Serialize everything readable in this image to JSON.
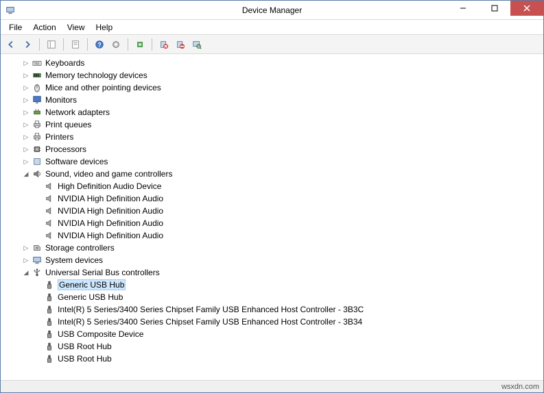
{
  "window": {
    "title": "Device Manager"
  },
  "menubar": [
    "File",
    "Action",
    "View",
    "Help"
  ],
  "toolbar_icons": [
    "nav-back-icon",
    "nav-forward-icon",
    "|",
    "show-hide-tree-icon",
    "|",
    "properties-icon",
    "|",
    "help-icon",
    "action-icon",
    "|",
    "update-driver-icon",
    "|",
    "uninstall-icon",
    "disable-icon",
    "scan-hardware-icon"
  ],
  "tree": [
    {
      "depth": 1,
      "exp": "collapsed",
      "icon": "keyboard-icon",
      "label": "Keyboards"
    },
    {
      "depth": 1,
      "exp": "collapsed",
      "icon": "memory-tech-icon",
      "label": "Memory technology devices"
    },
    {
      "depth": 1,
      "exp": "collapsed",
      "icon": "mouse-icon",
      "label": "Mice and other pointing devices"
    },
    {
      "depth": 1,
      "exp": "collapsed",
      "icon": "monitor-icon",
      "label": "Monitors"
    },
    {
      "depth": 1,
      "exp": "collapsed",
      "icon": "network-icon",
      "label": "Network adapters"
    },
    {
      "depth": 1,
      "exp": "collapsed",
      "icon": "print-queue-icon",
      "label": "Print queues"
    },
    {
      "depth": 1,
      "exp": "collapsed",
      "icon": "printer-icon",
      "label": "Printers"
    },
    {
      "depth": 1,
      "exp": "collapsed",
      "icon": "processor-icon",
      "label": "Processors"
    },
    {
      "depth": 1,
      "exp": "collapsed",
      "icon": "software-device-icon",
      "label": "Software devices"
    },
    {
      "depth": 1,
      "exp": "expanded",
      "icon": "sound-icon",
      "label": "Sound, video and game controllers"
    },
    {
      "depth": 2,
      "exp": "none",
      "icon": "audio-device-icon",
      "label": "High Definition Audio Device"
    },
    {
      "depth": 2,
      "exp": "none",
      "icon": "audio-device-icon",
      "label": "NVIDIA High Definition Audio"
    },
    {
      "depth": 2,
      "exp": "none",
      "icon": "audio-device-icon",
      "label": "NVIDIA High Definition Audio"
    },
    {
      "depth": 2,
      "exp": "none",
      "icon": "audio-device-icon",
      "label": "NVIDIA High Definition Audio"
    },
    {
      "depth": 2,
      "exp": "none",
      "icon": "audio-device-icon",
      "label": "NVIDIA High Definition Audio"
    },
    {
      "depth": 1,
      "exp": "collapsed",
      "icon": "storage-icon",
      "label": "Storage controllers"
    },
    {
      "depth": 1,
      "exp": "collapsed",
      "icon": "system-device-icon",
      "label": "System devices"
    },
    {
      "depth": 1,
      "exp": "expanded",
      "icon": "usb-controller-icon",
      "label": "Universal Serial Bus controllers"
    },
    {
      "depth": 2,
      "exp": "none",
      "icon": "usb-device-icon",
      "label": "Generic USB Hub",
      "selected": true
    },
    {
      "depth": 2,
      "exp": "none",
      "icon": "usb-device-icon",
      "label": "Generic USB Hub"
    },
    {
      "depth": 2,
      "exp": "none",
      "icon": "usb-device-icon",
      "label": "Intel(R) 5 Series/3400 Series Chipset Family USB Enhanced Host Controller - 3B3C"
    },
    {
      "depth": 2,
      "exp": "none",
      "icon": "usb-device-icon",
      "label": "Intel(R) 5 Series/3400 Series Chipset Family USB Enhanced Host Controller - 3B34"
    },
    {
      "depth": 2,
      "exp": "none",
      "icon": "usb-device-icon",
      "label": "USB Composite Device"
    },
    {
      "depth": 2,
      "exp": "none",
      "icon": "usb-device-icon",
      "label": "USB Root Hub"
    },
    {
      "depth": 2,
      "exp": "none",
      "icon": "usb-device-icon",
      "label": "USB Root Hub"
    }
  ],
  "statusbar": {
    "text": "wsxdn.com"
  },
  "icons_svg": {
    "computer": "<svg width='14' height='14' viewBox='0 0 16 16'><rect x='2' y='3' width='12' height='8' fill='#b8d0e8' stroke='#3a5a8a'/><rect x='5' y='12' width='6' height='2' fill='#888'/></svg>",
    "keyboard": "<svg width='14' height='14' viewBox='0 0 16 16'><rect x='1' y='5' width='14' height='7' rx='1' fill='#e8e8e8' stroke='#666'/><rect x='3' y='7' width='2' height='1' fill='#555'/><rect x='6' y='7' width='2' height='1' fill='#555'/><rect x='9' y='7' width='2' height='1' fill='#555'/><rect x='4' y='9' width='8' height='1' fill='#555'/></svg>",
    "mouse": "<svg width='14' height='14' viewBox='0 0 16 16'><ellipse cx='8' cy='9' rx='4' ry='6' fill='#ddd' stroke='#555'/><line x1='8' y1='3' x2='8' y2='8' stroke='#555'/></svg>",
    "monitor": "<svg width='14' height='14' viewBox='0 0 16 16'><rect x='2' y='2' width='12' height='9' fill='#4b7bc8' stroke='#2a4a7a'/><rect x='6' y='12' width='4' height='2' fill='#888'/></svg>",
    "network": "<svg width='14' height='14' viewBox='0 0 16 16'><rect x='3' y='6' width='10' height='5' fill='#6a9a4a' stroke='#3a6a2a'/><rect x='5' y='3' width='2' height='3' fill='#888'/><rect x='9' y='3' width='2' height='3' fill='#888'/></svg>",
    "printer": "<svg width='14' height='14' viewBox='0 0 16 16'><rect x='3' y='6' width='10' height='5' fill='#c8c8c8' stroke='#666'/><rect x='5' y='2' width='6' height='4' fill='#fff' stroke='#666'/><rect x='5' y='10' width='6' height='3' fill='#fff' stroke='#666'/></svg>",
    "cpu": "<svg width='14' height='14' viewBox='0 0 16 16'><rect x='4' y='4' width='8' height='8' fill='#888' stroke='#444'/><rect x='6' y='6' width='4' height='4' fill='#bbb'/><line x1='2' y1='6' x2='4' y2='6' stroke='#444'/><line x1='2' y1='10' x2='4' y2='10' stroke='#444'/><line x1='12' y1='6' x2='14' y2='6' stroke='#444'/><line x1='12' y1='10' x2='14' y2='10' stroke='#444'/></svg>",
    "device": "<svg width='14' height='14' viewBox='0 0 16 16'><rect x='3' y='3' width='10' height='10' fill='#c8d8e8' stroke='#5a7a9a'/></svg>",
    "sound": "<svg width='14' height='14' viewBox='0 0 16 16'><polygon points='3,6 6,6 10,3 10,13 6,10 3,10' fill='#888' stroke='#555'/><path d='M12 5 Q14 8 12 11' fill='none' stroke='#555'/></svg>",
    "speaker": "<svg width='14' height='14' viewBox='0 0 16 16'><polygon points='3,6 6,6 10,3 10,13 6,10 3,10' fill='#aaa' stroke='#666'/></svg>",
    "storage": "<svg width='14' height='14' viewBox='0 0 16 16'><path d='M3 4 L10 4 L13 7 L13 12 L3 12 Z' fill='#ccc' stroke='#666'/><circle cx='8' cy='8' r='2' fill='#888'/></svg>",
    "usb": "<svg width='14' height='14' viewBox='0 0 16 16'><rect x='6' y='2' width='4' height='5' fill='#555'/><rect x='5' y='7' width='6' height='7' rx='1' fill='#999' stroke='#555'/></svg>",
    "usbctrl": "<svg width='14' height='14' viewBox='0 0 16 16'><circle cx='8' cy='12' r='2' fill='#555'/><line x1='8' y1='12' x2='8' y2='3' stroke='#555' stroke-width='1.5'/><circle cx='8' cy='3' r='1.5' fill='#555'/><line x1='8' y1='9' x2='4' y2='6' stroke='#555'/><rect x='3' y='4' width='2' height='2' fill='#555'/><line x1='8' y1='8' x2='12' y2='5' stroke='#555'/><circle cx='12' cy='5' r='1' fill='#555'/></svg>",
    "memtech": "<svg width='14' height='14' viewBox='0 0 16 16'><rect x='2' y='5' width='12' height='6' fill='#5a8a5a' stroke='#3a6a3a'/><rect x='3' y='6' width='2' height='4' fill='#222'/><rect x='6' y='6' width='2' height='4' fill='#222'/><rect x='9' y='6' width='2' height='4' fill='#222'/></svg>",
    "arrow-l": "<svg width='14' height='14' viewBox='0 0 16 16'><path d='M10 3 L5 8 L10 13' fill='none' stroke='#3a6a9a' stroke-width='2'/></svg>",
    "arrow-r": "<svg width='14' height='14' viewBox='0 0 16 16'><path d='M6 3 L11 8 L6 13' fill='none' stroke='#3a6a9a' stroke-width='2'/></svg>",
    "tree-pane": "<svg width='14' height='14' viewBox='0 0 16 16'><rect x='2' y='2' width='12' height='12' fill='#fff' stroke='#888'/><line x1='6' y1='2' x2='6' y2='14' stroke='#888'/></svg>",
    "prop": "<svg width='14' height='14' viewBox='0 0 16 16'><rect x='3' y='2' width='10' height='12' fill='#fff' stroke='#888'/><line x1='5' y1='5' x2='11' y2='5' stroke='#888'/><line x1='5' y1='8' x2='11' y2='8' stroke='#888'/></svg>",
    "help": "<svg width='14' height='14' viewBox='0 0 16 16'><circle cx='8' cy='8' r='6' fill='#4a7ac8' stroke='#2a5a9a'/><text x='8' y='12' text-anchor='middle' fill='#fff' font-size='10' font-weight='bold'>?</text></svg>",
    "gear": "<svg width='14' height='14' viewBox='0 0 16 16'><circle cx='8' cy='8' r='5' fill='#ccc' stroke='#666'/><circle cx='8' cy='8' r='2' fill='#fff'/></svg>",
    "update": "<svg width='14' height='14' viewBox='0 0 16 16'><rect x='4' y='4' width='8' height='8' fill='#6aba6a' stroke='#3a8a3a'/><path d='M8 6 L8 10 M6 8 L10 8' stroke='#fff' stroke-width='1.5'/></svg>",
    "uninst": "<svg width='14' height='14' viewBox='0 0 16 16'><rect x='3' y='3' width='8' height='10' fill='#c8d8e8' stroke='#5a7a9a'/><circle cx='11' cy='11' r='4' fill='#d04040'/><path d='M9 9 L13 13 M13 9 L9 13' stroke='#fff' stroke-width='1.5'/></svg>",
    "disable": "<svg width='14' height='14' viewBox='0 0 16 16'><rect x='3' y='3' width='8' height='10' fill='#c8d8e8' stroke='#5a7a9a'/><circle cx='11' cy='11' r='4' fill='#d04040'/><line x1='8' y1='11' x2='14' y2='11' stroke='#fff' stroke-width='2'/></svg>",
    "scan": "<svg width='14' height='14' viewBox='0 0 16 16'><rect x='2' y='3' width='10' height='8' fill='#c8d8e8' stroke='#5a7a9a'/><circle cx='11' cy='11' r='3' fill='none' stroke='#3a7a3a' stroke-width='1.5'/><line x1='13' y1='13' x2='15' y2='15' stroke='#3a7a3a' stroke-width='1.5'/></svg>"
  },
  "icon_map": {
    "keyboard-icon": "keyboard",
    "memory-tech-icon": "memtech",
    "mouse-icon": "mouse",
    "monitor-icon": "monitor",
    "network-icon": "network",
    "print-queue-icon": "printer",
    "printer-icon": "printer",
    "processor-icon": "cpu",
    "software-device-icon": "device",
    "sound-icon": "sound",
    "audio-device-icon": "speaker",
    "storage-icon": "storage",
    "system-device-icon": "computer",
    "usb-controller-icon": "usbctrl",
    "usb-device-icon": "usb",
    "nav-back-icon": "arrow-l",
    "nav-forward-icon": "arrow-r",
    "show-hide-tree-icon": "tree-pane",
    "properties-icon": "prop",
    "help-icon": "help",
    "action-icon": "gear",
    "update-driver-icon": "update",
    "uninstall-icon": "uninst",
    "disable-icon": "disable",
    "scan-hardware-icon": "scan",
    "app-icon": "computer"
  }
}
